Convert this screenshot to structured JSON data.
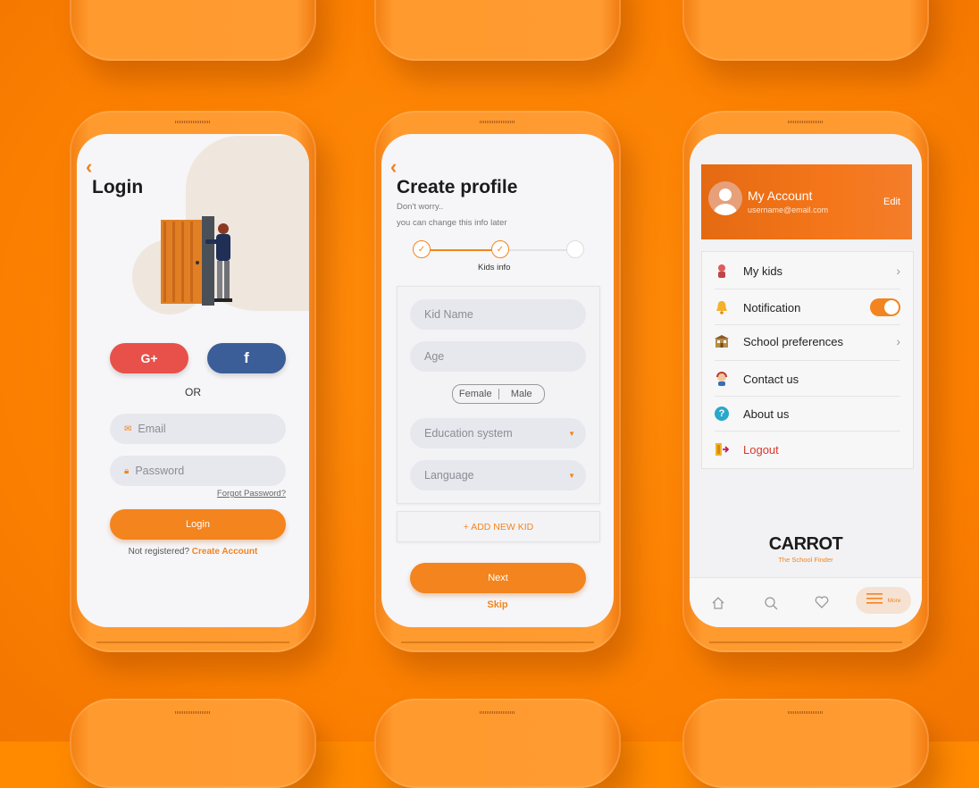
{
  "login": {
    "title": "Login",
    "google_label": "G+",
    "facebook_label": "f",
    "or_label": "OR",
    "email_placeholder": "Email",
    "password_placeholder": "Password",
    "forgot_label": "Forgot Password?",
    "login_button": "Login",
    "not_registered": "Not registered?",
    "create_account": "Create Account"
  },
  "create_profile": {
    "title": "Create profile",
    "subtitle_1": "Don't worry..",
    "subtitle_2": "you can change this info later",
    "step_label": "Kids info",
    "kid_name_placeholder": "Kid Name",
    "age_placeholder": "Age",
    "gender_female": "Female",
    "gender_male": "Male",
    "education_placeholder": "Education system",
    "language_placeholder": "Language",
    "add_kid": "+ ADD NEW KID",
    "next_button": "Next",
    "skip_button": "Skip"
  },
  "account": {
    "title": "My Account",
    "email": "username@email.com",
    "edit_label": "Edit",
    "menu": [
      {
        "label": "My kids",
        "icon": "kid-icon"
      },
      {
        "label": "Notification",
        "icon": "bell-icon"
      },
      {
        "label": "School preferences",
        "icon": "school-icon"
      },
      {
        "label": "Contact us",
        "icon": "support-icon"
      },
      {
        "label": "About us",
        "icon": "help-icon"
      },
      {
        "label": "Logout",
        "icon": "logout-icon"
      }
    ],
    "brand_name": "CARROT",
    "brand_tagline": "The School Finder",
    "nav_more": "More"
  },
  "colors": {
    "accent": "#f3841e",
    "background": "#ff8a00",
    "google": "#e8504a",
    "facebook": "#3b5e98",
    "logout": "#d9392c"
  }
}
